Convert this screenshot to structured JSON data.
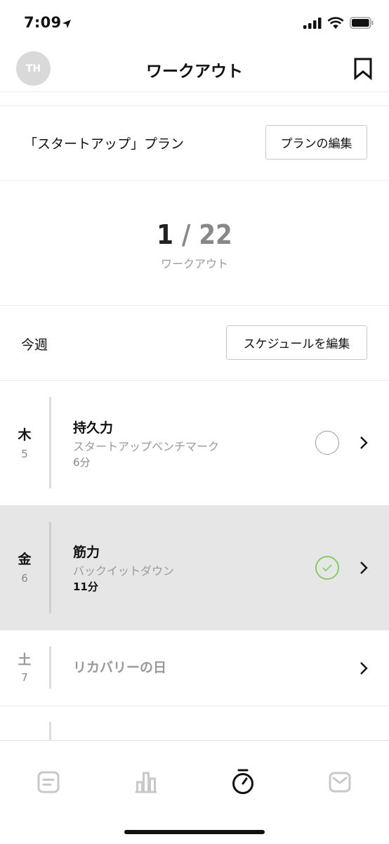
{
  "status": {
    "time": "7:09"
  },
  "header": {
    "avatar": "TH",
    "title": "ワークアウト"
  },
  "plan": {
    "name": "「スタートアップ」プラン",
    "edit_label": "プランの編集"
  },
  "progress": {
    "current": "1",
    "separator": "/",
    "total": "22",
    "label": "ワークアウト"
  },
  "week": {
    "label": "今週",
    "edit_label": "スケジュールを編集"
  },
  "workouts": [
    {
      "day": "木",
      "date": "5",
      "title": "持久力",
      "subtitle": "スタートアップベンチマーク",
      "duration": "6分",
      "status": "pending"
    },
    {
      "day": "金",
      "date": "6",
      "title": "筋力",
      "subtitle": "バックイットダウン",
      "duration": "11分",
      "status": "completed"
    },
    {
      "day": "土",
      "date": "7",
      "title": "リカバリーの日",
      "status": "rest"
    }
  ],
  "colors": {
    "accent_green": "#7bd35c",
    "selected_bg": "#e6e6e6"
  },
  "tabbar": {
    "icons": [
      "log-icon",
      "stats-icon",
      "timer-icon",
      "mail-icon"
    ],
    "active": "timer-icon"
  }
}
